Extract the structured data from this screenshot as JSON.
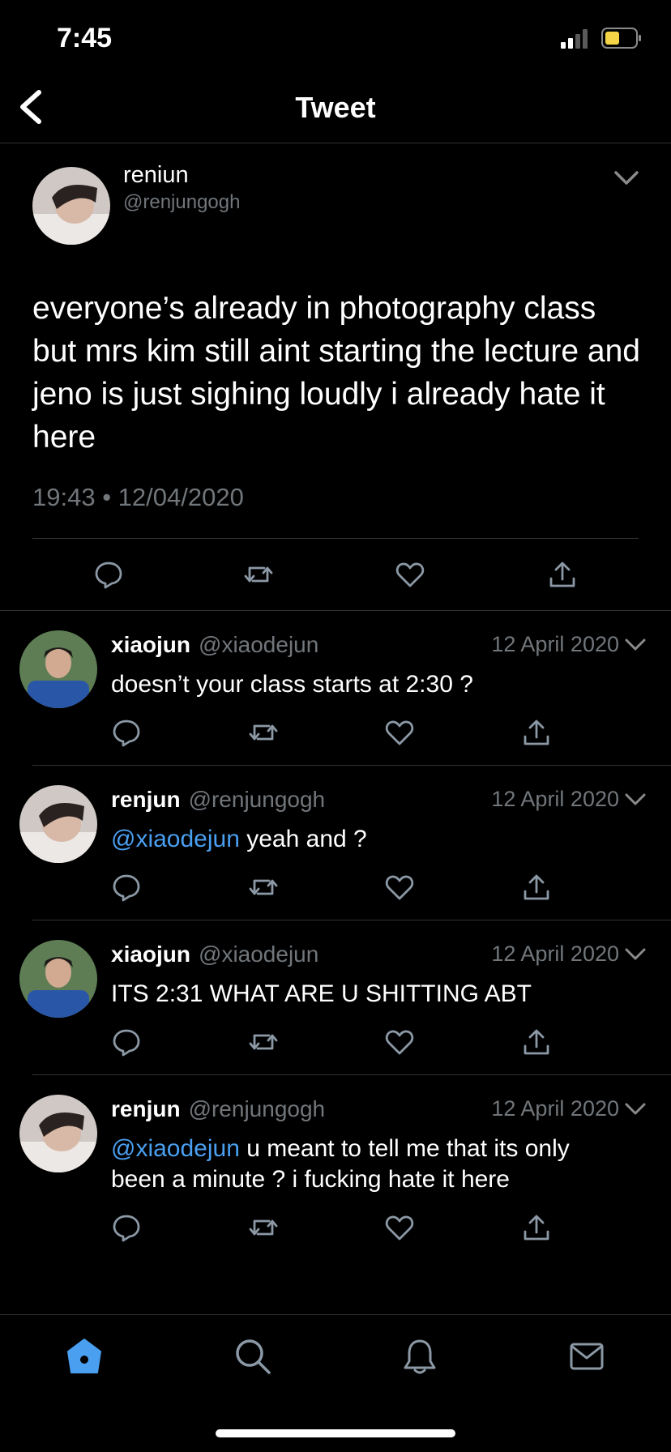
{
  "status_bar": {
    "time": "7:45"
  },
  "header": {
    "title": "Tweet"
  },
  "main_tweet": {
    "name": "reniun",
    "handle": "@renjungogh",
    "text": "everyone’s already in photography class but mrs kim still aint starting the lecture and jeno is just sighing loudly i already hate it here",
    "timestamp": "19:43 • 12/04/2020"
  },
  "replies": [
    {
      "name": "xiaojun",
      "handle": "@xiaodejun",
      "date": "12 April 2020",
      "mention": "",
      "text": "doesn’t your class starts at 2:30 ?"
    },
    {
      "name": "renjun",
      "handle": "@renjungogh",
      "date": "12 April 2020",
      "mention": "@xiaodejun",
      "text": " yeah and ?"
    },
    {
      "name": "xiaojun",
      "handle": "@xiaodejun",
      "date": "12 April 2020",
      "mention": "",
      "text": "ITS 2:31 WHAT ARE U SHITTING ABT"
    },
    {
      "name": "renjun",
      "handle": "@renjungogh",
      "date": "12 April 2020",
      "mention": "@xiaodejun",
      "text": " u meant to tell me that its only been a minute ? i fucking hate it here"
    }
  ],
  "icons": {
    "reply": "reply-icon",
    "retweet": "retweet-icon",
    "like": "heart-icon",
    "share": "share-icon",
    "tabs": [
      "home-icon",
      "search-icon",
      "bell-icon",
      "mail-icon"
    ]
  },
  "colors": {
    "accent": "#4a9ff0",
    "secondary_text": "#71767b",
    "battery": "#f5d547"
  }
}
